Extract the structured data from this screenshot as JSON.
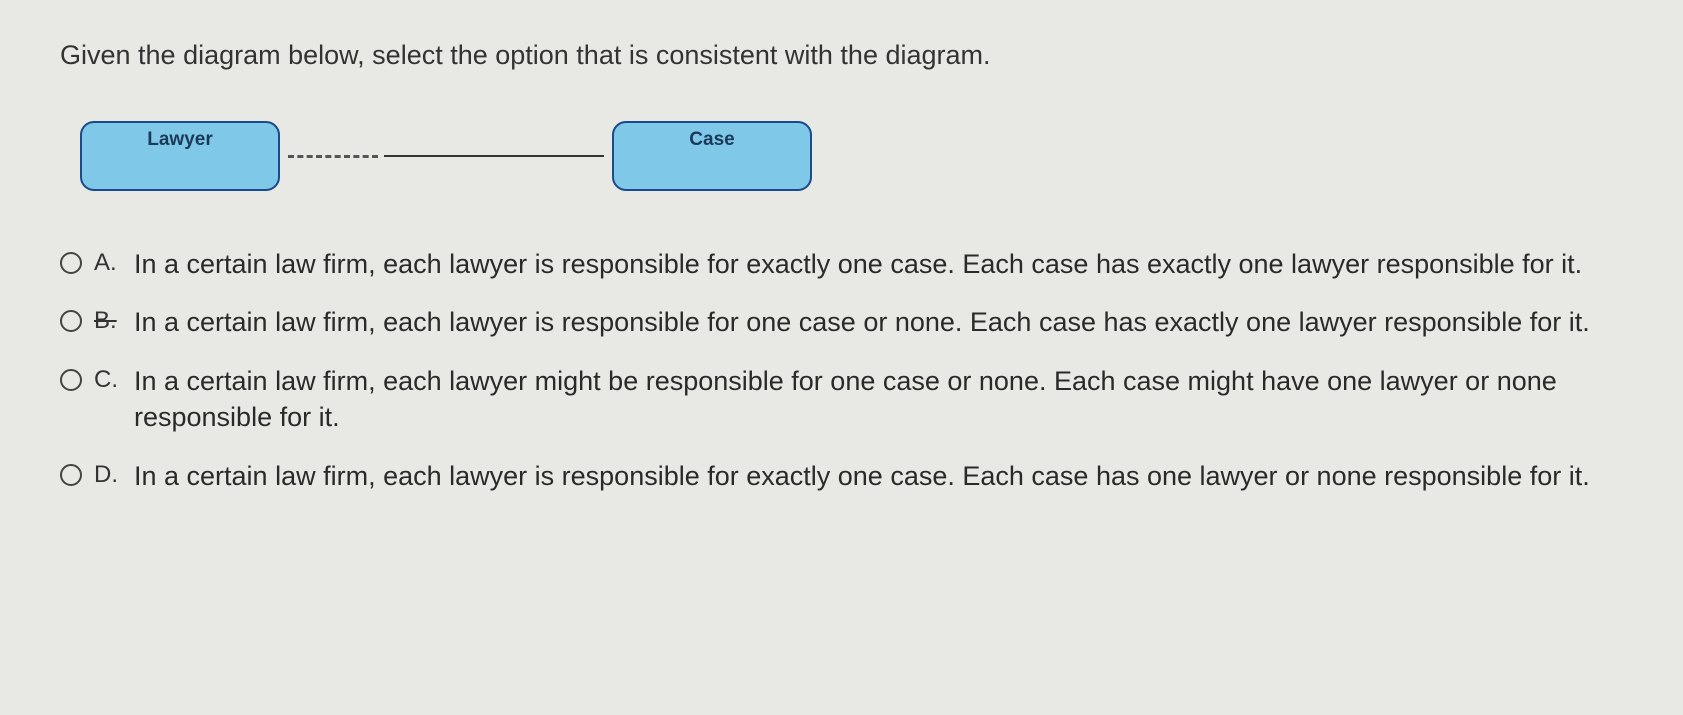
{
  "question": "Given the diagram below, select the option that is consistent with the diagram.",
  "diagram": {
    "entity1": "Lawyer",
    "entity2": "Case"
  },
  "options": {
    "a": {
      "label": "A.",
      "text": "In a certain law firm, each lawyer is responsible for exactly one case. Each case has exactly one lawyer responsible for it."
    },
    "b": {
      "label": "B.",
      "text": "In a certain law firm, each lawyer is responsible for one case or none. Each case has exactly one lawyer responsible for it."
    },
    "c": {
      "label": "C.",
      "text": "In a certain law firm, each lawyer might be responsible for one case or none. Each case might have one lawyer or none responsible for it."
    },
    "d": {
      "label": "D.",
      "text": "In a certain law firm, each lawyer is responsible for exactly one case. Each case has  one lawyer or none responsible for it."
    }
  }
}
